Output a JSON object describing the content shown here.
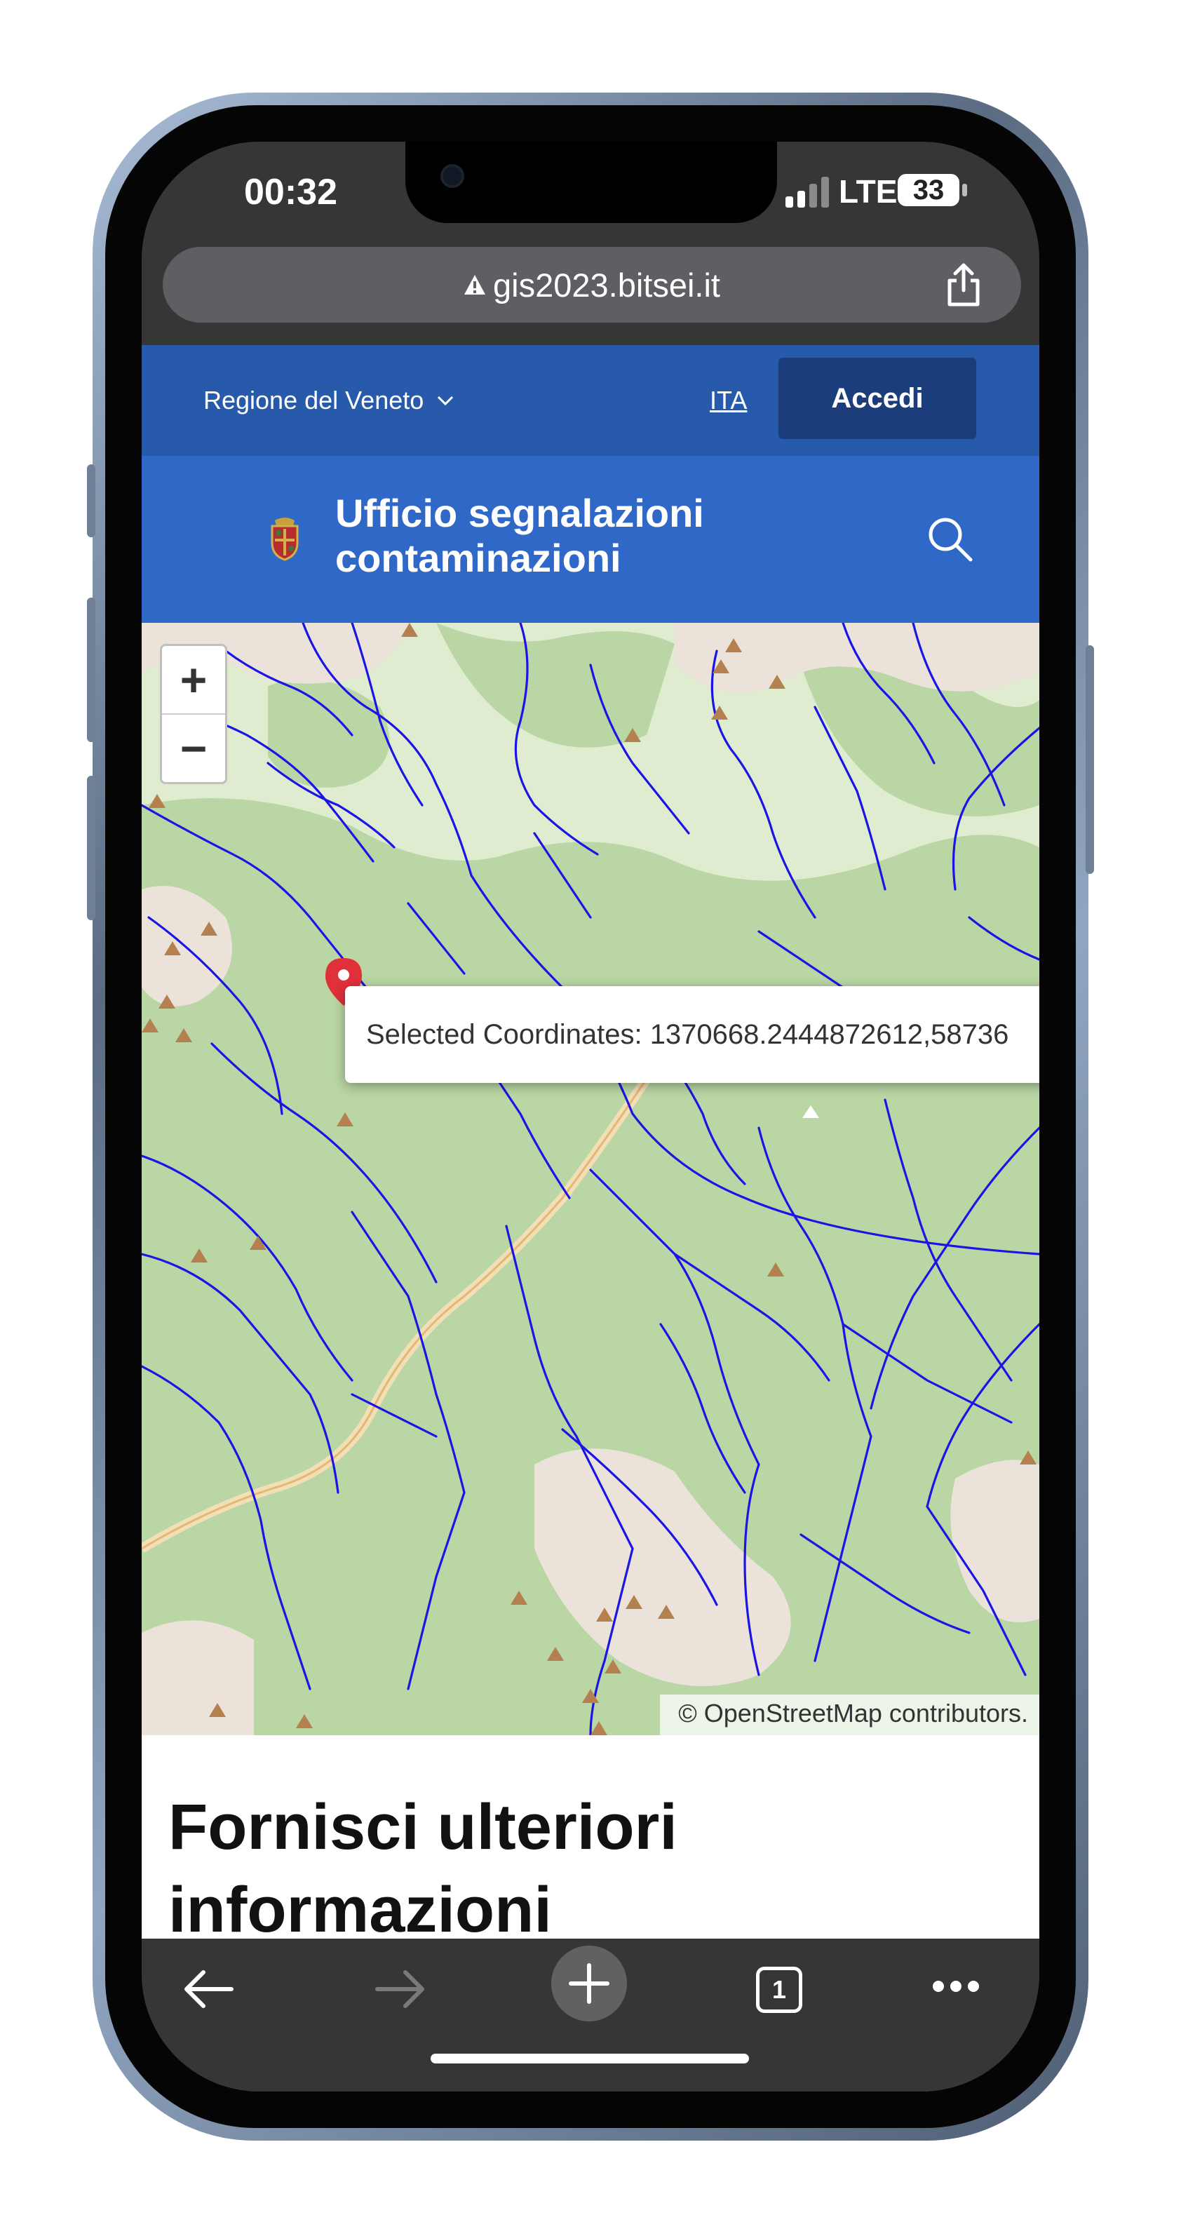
{
  "status_bar": {
    "time": "00:32",
    "network": "LTE",
    "battery": "33"
  },
  "browser": {
    "url": "gis2023.bitsei.it"
  },
  "top_bar": {
    "region": "Regione del Veneto",
    "language": "ITA",
    "login": "Accedi"
  },
  "header": {
    "title_line1": "Ufficio segnalazioni",
    "title_line2": "contaminazioni"
  },
  "map": {
    "zoom_in": "+",
    "zoom_out": "−",
    "popup_text": "Selected Coordinates: 1370668.2444872612,58736",
    "attribution": "© OpenStreetMap contributors."
  },
  "content": {
    "heading": "Fornisci ulteriori informazioni"
  },
  "toolbar": {
    "tab_count": "1"
  },
  "colors": {
    "topbar": "#275aab",
    "header": "#2f68c7",
    "login_button": "#1b3d7c",
    "river": "#1b14e6",
    "marker": "#e0303a",
    "map_green": "#b9d6a4"
  }
}
